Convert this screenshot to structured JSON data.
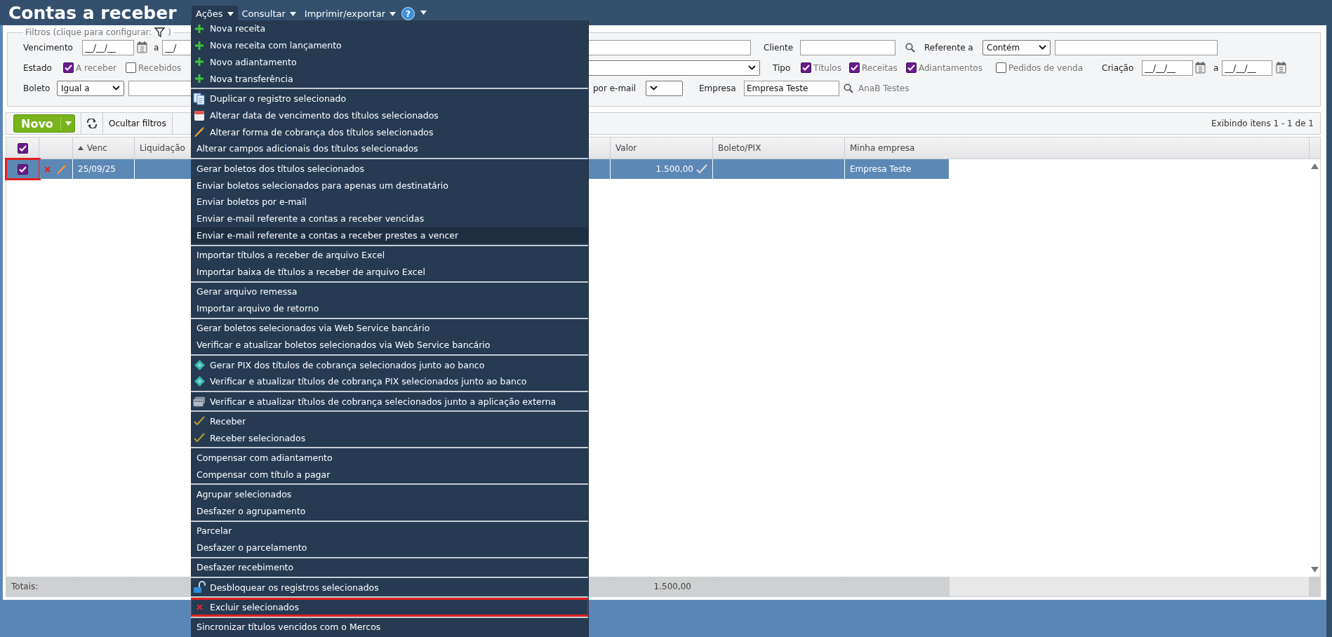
{
  "header": {
    "title": "Contas a receber",
    "help": "?",
    "menus": [
      {
        "label": "Ações",
        "selected": true
      },
      {
        "label": "Consultar",
        "selected": false
      },
      {
        "label": "Imprimir/exportar",
        "selected": false
      }
    ]
  },
  "filters": {
    "legend_start": "Filtros (clique para configurar:",
    "legend_end": ")",
    "vencimento": {
      "label": "Vencimento",
      "from": "__/__/__",
      "sep": "a",
      "to": "__/"
    },
    "estado": {
      "label": "Estado",
      "options": [
        {
          "label": "A receber",
          "checked": true
        },
        {
          "label": "Recebidos",
          "checked": false
        }
      ]
    },
    "boleto": {
      "label": "Boleto",
      "select": "Igual a"
    },
    "cliente": {
      "label": "Cliente"
    },
    "referente": {
      "label": "Referente a",
      "select": "Contém"
    },
    "tipo": {
      "label": "Tipo",
      "options": [
        {
          "label": "Títulos",
          "checked": true
        },
        {
          "label": "Receitas",
          "checked": true
        },
        {
          "label": "Adiantamentos",
          "checked": true
        },
        {
          "label": "Pedidos de venda",
          "checked": false
        }
      ]
    },
    "criacao": {
      "label": "Criação",
      "from": "__/__/__",
      "sep": "a",
      "to": "__/__/__"
    },
    "email": {
      "label": "por e-mail"
    },
    "empresa": {
      "label": "Empresa",
      "value": "Empresa Teste",
      "hint": "AnaB Testes"
    }
  },
  "toolbar": {
    "new": "Novo",
    "hide_filters": "Ocultar filtros",
    "summary": "Exibindo itens 1 - 1 de 1"
  },
  "table": {
    "header_checked": true,
    "columns": [
      {
        "label": "Venc",
        "sorted": true
      },
      {
        "label": "Liquidação",
        "sorted": false
      },
      {
        "label": "Valor",
        "sorted": false
      },
      {
        "label": "Boleto/PIX",
        "sorted": false
      },
      {
        "label": "Minha empresa",
        "sorted": false
      }
    ],
    "rows": [
      {
        "selected": true,
        "checked": true,
        "highlighted": true,
        "venc": "25/09/25",
        "valor": "1.500,00",
        "confirmed": true,
        "empresa": "Empresa Teste"
      }
    ],
    "totals": {
      "label": "Totais:",
      "valor": "1.500,00"
    }
  },
  "menu": {
    "groups": [
      [
        {
          "kind": "add",
          "label": "Nova receita",
          "hovered": false,
          "highlighted": false
        },
        {
          "kind": "add",
          "label": "Nova receita com lançamento",
          "hovered": false,
          "highlighted": false
        },
        {
          "kind": "add",
          "label": "Novo adiantamento",
          "hovered": false,
          "highlighted": false
        },
        {
          "kind": "add",
          "label": "Nova transferência",
          "hovered": false,
          "highlighted": false
        }
      ],
      [
        {
          "kind": "duplicate",
          "label": "Duplicar o registro selecionado",
          "hovered": false,
          "highlighted": false
        },
        {
          "kind": "date",
          "label": "Alterar data de vencimento dos títulos selecionados",
          "hovered": false,
          "highlighted": false
        },
        {
          "kind": "edit",
          "label": "Alterar forma de cobrança dos títulos selecionados",
          "hovered": false,
          "highlighted": false
        },
        {
          "kind": "plain",
          "label": "Alterar campos adicionais dos títulos selecionados",
          "hovered": false,
          "highlighted": false
        }
      ],
      [
        {
          "kind": "plain",
          "label": "Gerar boletos dos títulos selecionados",
          "hovered": false,
          "highlighted": false
        },
        {
          "kind": "plain",
          "label": "Enviar boletos selecionados para apenas um destinatário",
          "hovered": false,
          "highlighted": false
        },
        {
          "kind": "plain",
          "label": "Enviar boletos por e-mail",
          "hovered": false,
          "highlighted": false
        },
        {
          "kind": "plain",
          "label": "Enviar e-mail referente a contas a receber vencidas",
          "hovered": false,
          "highlighted": false
        },
        {
          "kind": "plain",
          "label": "Enviar e-mail referente a contas a receber prestes a vencer",
          "hovered": true,
          "highlighted": false
        }
      ],
      [
        {
          "kind": "plain",
          "label": "Importar títulos a receber de arquivo Excel",
          "hovered": false,
          "highlighted": false
        },
        {
          "kind": "plain",
          "label": "Importar baixa de títulos a receber de arquivo Excel",
          "hovered": false,
          "highlighted": false
        }
      ],
      [
        {
          "kind": "plain",
          "label": "Gerar arquivo remessa",
          "hovered": false,
          "highlighted": false
        },
        {
          "kind": "plain",
          "label": "Importar arquivo de retorno",
          "hovered": false,
          "highlighted": false
        }
      ],
      [
        {
          "kind": "plain",
          "label": "Gerar boletos selecionados via Web Service bancário",
          "hovered": false,
          "highlighted": false
        },
        {
          "kind": "plain",
          "label": "Verificar e atualizar boletos selecionados via Web Service bancário",
          "hovered": false,
          "highlighted": false
        }
      ],
      [
        {
          "kind": "pix",
          "label": "Gerar PIX dos títulos de cobrança selecionados junto ao banco",
          "hovered": false,
          "highlighted": false
        },
        {
          "kind": "pix",
          "label": "Verificar e atualizar títulos de cobrança PIX selecionados junto ao banco",
          "hovered": false,
          "highlighted": false
        }
      ],
      [
        {
          "kind": "external",
          "label": "Verificar e atualizar títulos de cobrança selecionados junto a aplicação externa",
          "hovered": false,
          "highlighted": false
        }
      ],
      [
        {
          "kind": "receive",
          "label": "Receber",
          "hovered": false,
          "highlighted": false
        },
        {
          "kind": "receive",
          "label": "Receber selecionados",
          "hovered": false,
          "highlighted": false
        }
      ],
      [
        {
          "kind": "plain",
          "label": "Compensar com adiantamento",
          "hovered": false,
          "highlighted": false
        },
        {
          "kind": "plain",
          "label": "Compensar com título a pagar",
          "hovered": false,
          "highlighted": false
        }
      ],
      [
        {
          "kind": "plain",
          "label": "Agrupar selecionados",
          "hovered": false,
          "highlighted": false
        },
        {
          "kind": "plain",
          "label": "Desfazer o agrupamento",
          "hovered": false,
          "highlighted": false
        }
      ],
      [
        {
          "kind": "plain",
          "label": "Parcelar",
          "hovered": false,
          "highlighted": false
        },
        {
          "kind": "plain",
          "label": "Desfazer o parcelamento",
          "hovered": false,
          "highlighted": false
        }
      ],
      [
        {
          "kind": "plain",
          "label": "Desfazer recebimento",
          "hovered": false,
          "highlighted": false
        }
      ],
      [
        {
          "kind": "unlock",
          "label": "Desbloquear os registros selecionados",
          "hovered": false,
          "highlighted": false
        }
      ],
      [
        {
          "kind": "delete",
          "label": "Excluir selecionados",
          "hovered": false,
          "highlighted": true
        }
      ],
      [
        {
          "kind": "plain",
          "label": "Sincronizar títulos vencidos com o Mercos",
          "hovered": false,
          "highlighted": false
        }
      ]
    ]
  }
}
